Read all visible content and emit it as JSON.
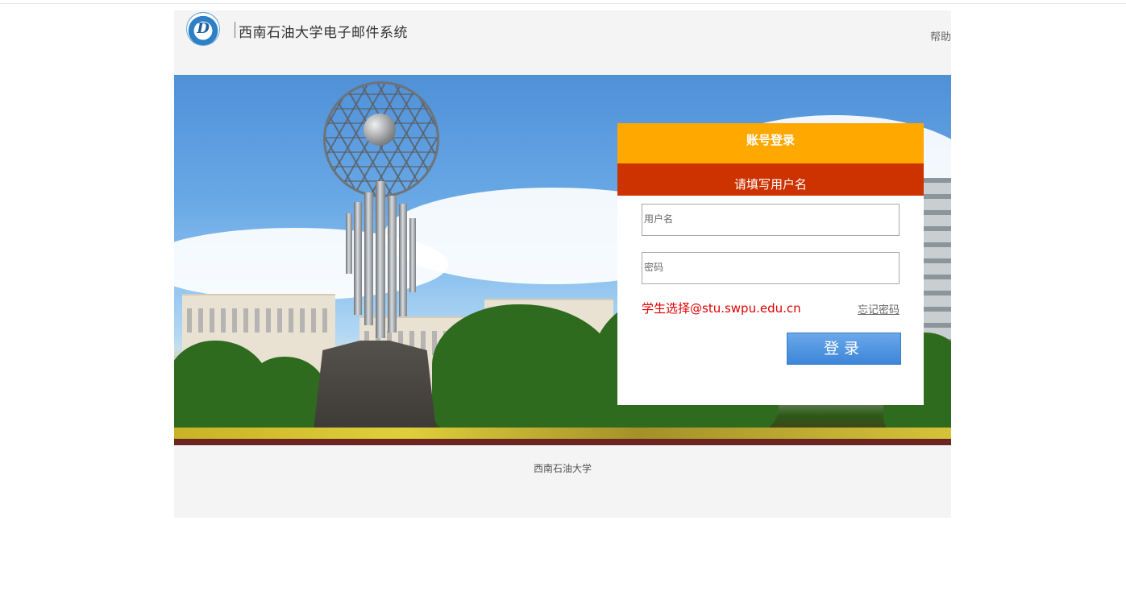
{
  "header": {
    "logo_text": "D",
    "title": "西南石油大学电子邮件系统",
    "help_label": "帮助"
  },
  "login": {
    "heading": "账号登录",
    "error_message": "请填写用户名",
    "username_placeholder": "用户名",
    "password_placeholder": "密码",
    "student_hint": "学生选择@stu.swpu.edu.cn",
    "forgot_label": "忘记密码",
    "submit_label": "登录"
  },
  "footer": {
    "text": "西南石油大学"
  },
  "colors": {
    "accent_orange": "#ffa800",
    "error_red": "#cc3300",
    "hint_red": "#e00000",
    "button_blue": "#4a90e2"
  },
  "icons": {
    "logo": "university-logo-icon"
  }
}
